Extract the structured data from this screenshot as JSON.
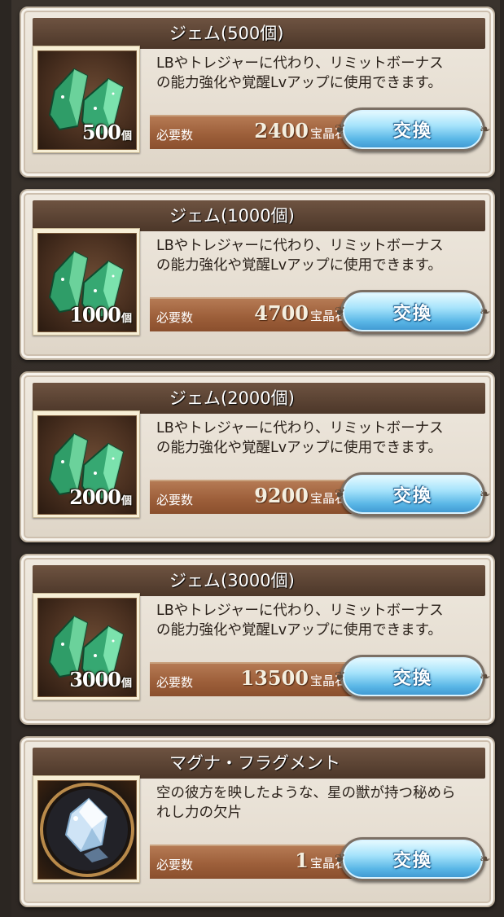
{
  "items": [
    {
      "title": "ジェム(500個)",
      "desc_line1": "LBやトレジャーに代わり、リミットボーナス",
      "desc_line2": "の能力強化や覚醒Lvアップに使用できます。",
      "qty_num": "500",
      "qty_unit": "個",
      "cost_label": "必要数",
      "cost": "2400",
      "cost_unit": "宝晶石",
      "button": "交換",
      "icon": "green-gem-crystals"
    },
    {
      "title": "ジェム(1000個)",
      "desc_line1": "LBやトレジャーに代わり、リミットボーナス",
      "desc_line2": "の能力強化や覚醒Lvアップに使用できます。",
      "qty_num": "1000",
      "qty_unit": "個",
      "cost_label": "必要数",
      "cost": "4700",
      "cost_unit": "宝晶石",
      "button": "交換",
      "icon": "green-gem-crystals"
    },
    {
      "title": "ジェム(2000個)",
      "desc_line1": "LBやトレジャーに代わり、リミットボーナス",
      "desc_line2": "の能力強化や覚醒Lvアップに使用できます。",
      "qty_num": "2000",
      "qty_unit": "個",
      "cost_label": "必要数",
      "cost": "9200",
      "cost_unit": "宝晶石",
      "button": "交換",
      "icon": "green-gem-crystals"
    },
    {
      "title": "ジェム(3000個)",
      "desc_line1": "LBやトレジャーに代わり、リミットボーナス",
      "desc_line2": "の能力強化や覚醒Lvアップに使用できます。",
      "qty_num": "3000",
      "qty_unit": "個",
      "cost_label": "必要数",
      "cost": "13500",
      "cost_unit": "宝晶石",
      "button": "交換",
      "icon": "green-gem-crystals"
    },
    {
      "title": "マグナ・フラグメント",
      "desc_line1": "空の彼方を映したような、星の獣が持つ秘めら",
      "desc_line2": "れし力の欠片",
      "qty_num": "",
      "qty_unit": "",
      "cost_label": "必要数",
      "cost": "1",
      "cost_unit": "宝晶石",
      "button": "交換",
      "icon": "magna-fragment-crystal"
    }
  ],
  "colors": {
    "title_bar": "#5a4233",
    "cost_bar": "#9d5f3a",
    "button": "#6cc3ec",
    "card": "#e9e2d7",
    "gem": "#3fbf7f"
  }
}
